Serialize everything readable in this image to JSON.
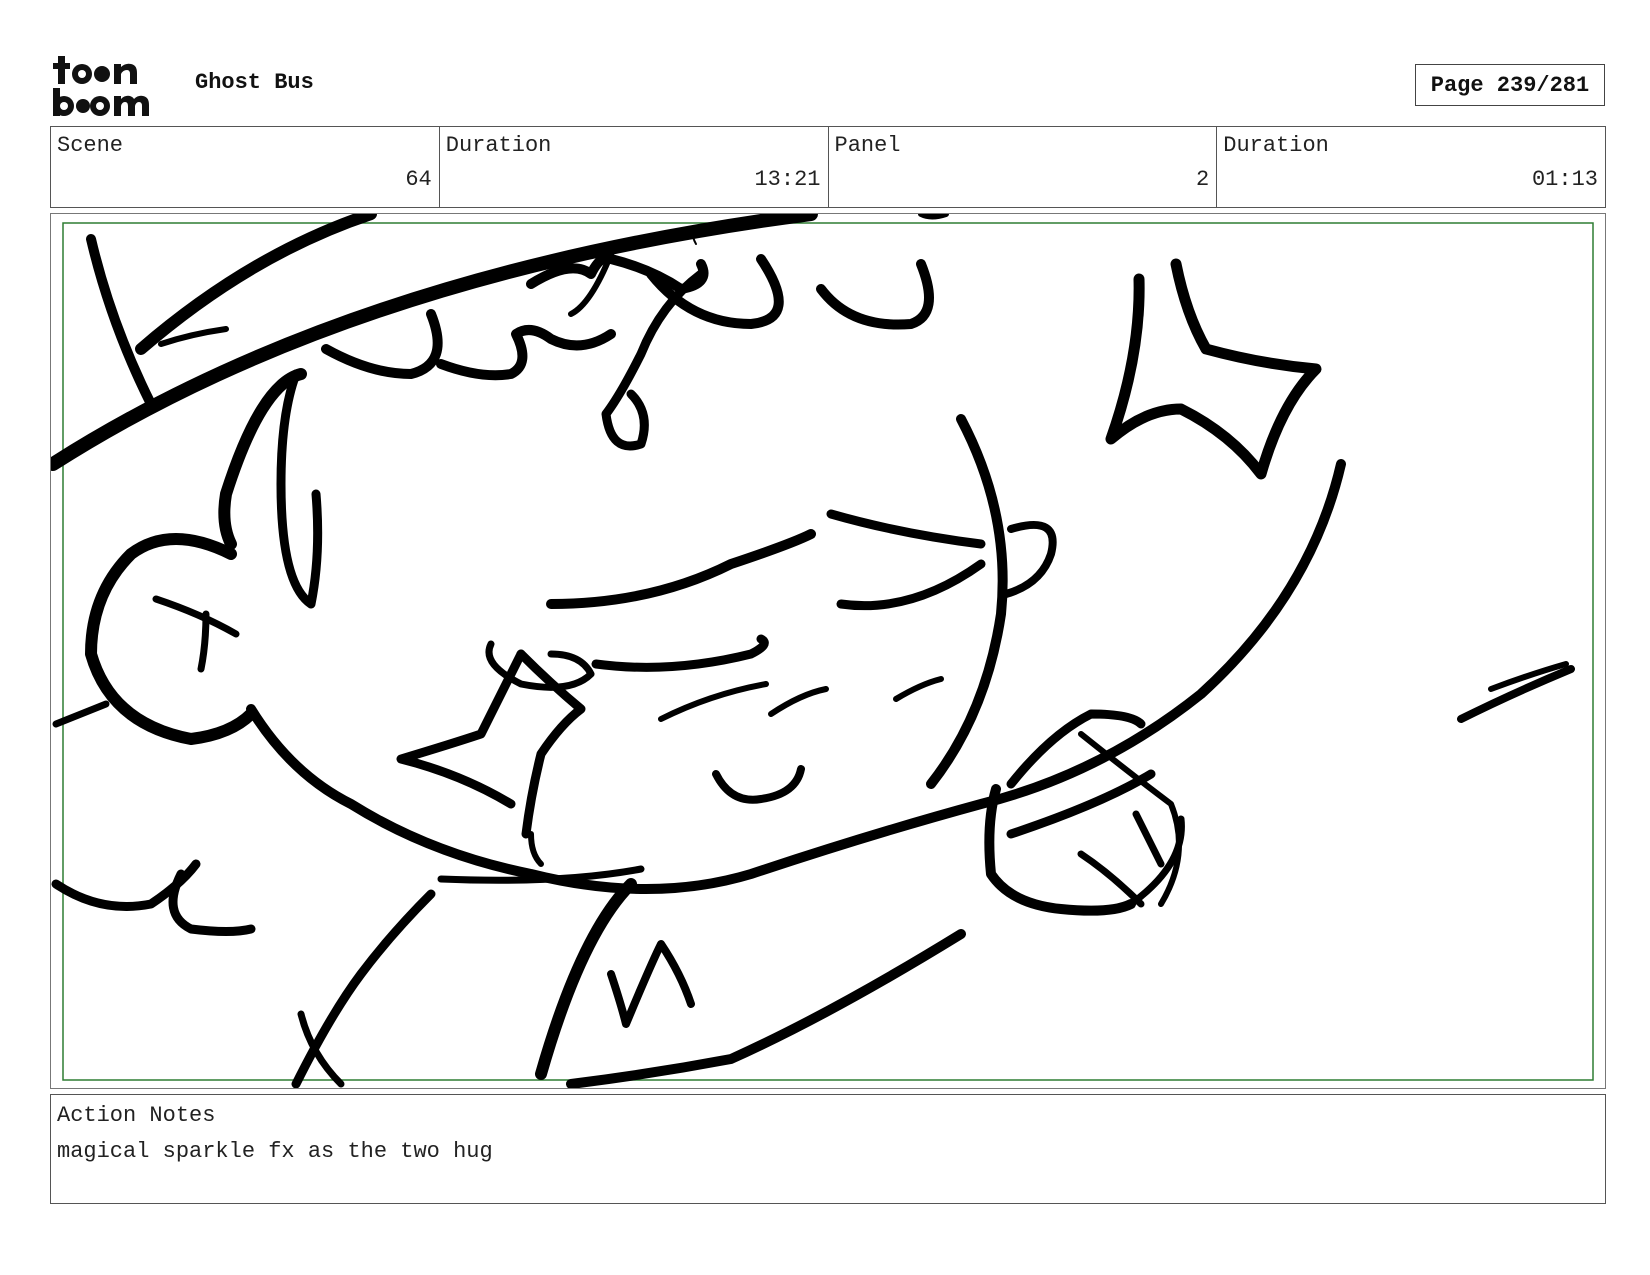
{
  "header": {
    "logo_text": [
      "to",
      "n",
      "b",
      "m"
    ],
    "project_title": "Ghost Bus",
    "page_label": "Page 239/281"
  },
  "info": {
    "scene_label": "Scene",
    "scene_value": "64",
    "scene_duration_label": "Duration",
    "scene_duration_value": "13:21",
    "panel_label": "Panel",
    "panel_value": "2",
    "panel_duration_label": "Duration",
    "panel_duration_value": "01:13"
  },
  "panel": {
    "safe_frame_color": "#2e7d32",
    "stroke_color": "#000000",
    "content": "rough sketch: sleeping character's face with sparkle stars"
  },
  "notes": {
    "label": "Action Notes",
    "text": "magical sparkle fx as the two hug"
  }
}
